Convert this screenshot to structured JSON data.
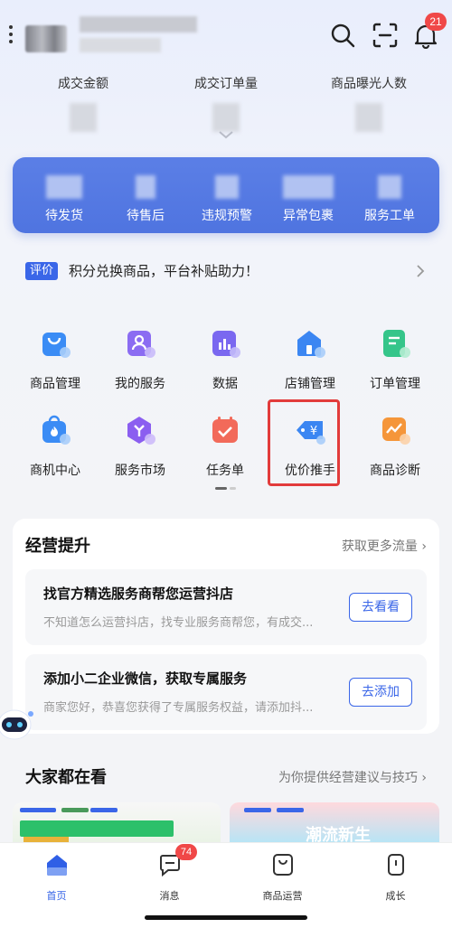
{
  "header": {
    "notification_count": "21"
  },
  "stats": [
    {
      "label": "成交金额"
    },
    {
      "label": "成交订单量"
    },
    {
      "label": "商品曝光人数"
    }
  ],
  "status": [
    {
      "label": "待发货"
    },
    {
      "label": "待售后"
    },
    {
      "label": "违规预警"
    },
    {
      "label": "异常包裹"
    },
    {
      "label": "服务工单"
    }
  ],
  "notice": {
    "tag": "评价",
    "text": "积分兑换商品，平台补贴助力！"
  },
  "grid": [
    {
      "label": "商品管理",
      "icon": "shopping-bag-icon",
      "color": "#3b8cf5"
    },
    {
      "label": "我的服务",
      "icon": "user-service-icon",
      "color": "#8b6cf2"
    },
    {
      "label": "数据",
      "icon": "bar-chart-icon",
      "color": "#7a68f0"
    },
    {
      "label": "店铺管理",
      "icon": "store-icon",
      "color": "#3b86f2"
    },
    {
      "label": "订单管理",
      "icon": "order-list-icon",
      "color": "#35c58a"
    },
    {
      "label": "商机中心",
      "icon": "flame-bag-icon",
      "color": "#3b8cf5"
    },
    {
      "label": "服务市场",
      "icon": "service-market-icon",
      "color": "#8b5ef0"
    },
    {
      "label": "任务单",
      "icon": "calendar-check-icon",
      "color": "#f26a5a"
    },
    {
      "label": "优价推手",
      "icon": "price-tag-icon",
      "color": "#3b86f2"
    },
    {
      "label": "商品诊断",
      "icon": "trend-chart-icon",
      "color": "#f5963a"
    }
  ],
  "growth": {
    "title": "经营提升",
    "more": "获取更多流量",
    "tasks": [
      {
        "title": "找官方精选服务商帮您运营抖店",
        "desc": "不知道怎么运营抖店，找专业服务商帮您，有成交...",
        "button": "去看看"
      },
      {
        "title": "添加小二企业微信，获取专属服务",
        "desc": "商家您好，恭喜您获得了专属服务权益，请添加抖...",
        "button": "去添加"
      }
    ]
  },
  "popular": {
    "title": "大家都在看",
    "more": "为你提供经营建议与技巧",
    "thumb_right_text": "潮流新生"
  },
  "tabbar": {
    "message_badge": "74",
    "tabs": [
      {
        "label": "首页"
      },
      {
        "label": "消息"
      },
      {
        "label": "商品运营"
      },
      {
        "label": "成长"
      }
    ]
  },
  "colors": {
    "accent": "#3a66e8",
    "highlight_border": "#e23b3b",
    "badge": "#f04848"
  }
}
